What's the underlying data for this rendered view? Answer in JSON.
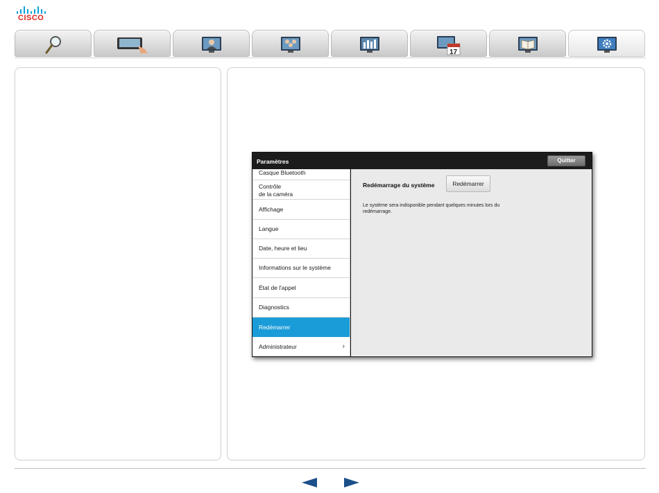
{
  "brand": {
    "name": "CISCO",
    "accent": "#049fd9",
    "wordmark_color": "#e2231a"
  },
  "tabs": [
    {
      "icon": "magnifier-icon"
    },
    {
      "icon": "touch-panel-icon"
    },
    {
      "icon": "video-call-icon"
    },
    {
      "icon": "multipoint-call-icon"
    },
    {
      "icon": "content-sharing-icon"
    },
    {
      "icon": "scheduled-meetings-icon"
    },
    {
      "icon": "phonebook-icon"
    },
    {
      "icon": "settings-icon",
      "active": true
    }
  ],
  "device": {
    "title": "Paramètres",
    "quit_label": "Quitter",
    "menu": [
      {
        "label": "Casque Bluetooth"
      },
      {
        "label": "Contrôle",
        "label2": "de la caméra"
      },
      {
        "label": "Affichage"
      },
      {
        "label": "Langue"
      },
      {
        "label": "Date, heure et lieu"
      },
      {
        "label": "Informations sur le système"
      },
      {
        "label": "État de l'appel"
      },
      {
        "label": "Diagnostics"
      },
      {
        "label": "Redémarrer",
        "selected": true
      },
      {
        "label": "Administrateur",
        "chevron": "chevron-right-icon"
      }
    ],
    "content": {
      "heading": "Redémarrage du système",
      "button_label": "Redémarrer",
      "description": "Le système sera indisponible pendant quelques minutes lors du redémarrage.",
      "selection_color": "#1a9cd8"
    }
  },
  "footer": {
    "prev_icon": "arrow-left-icon",
    "next_icon": "arrow-right-icon",
    "arrow_color": "#1b4f8a"
  }
}
